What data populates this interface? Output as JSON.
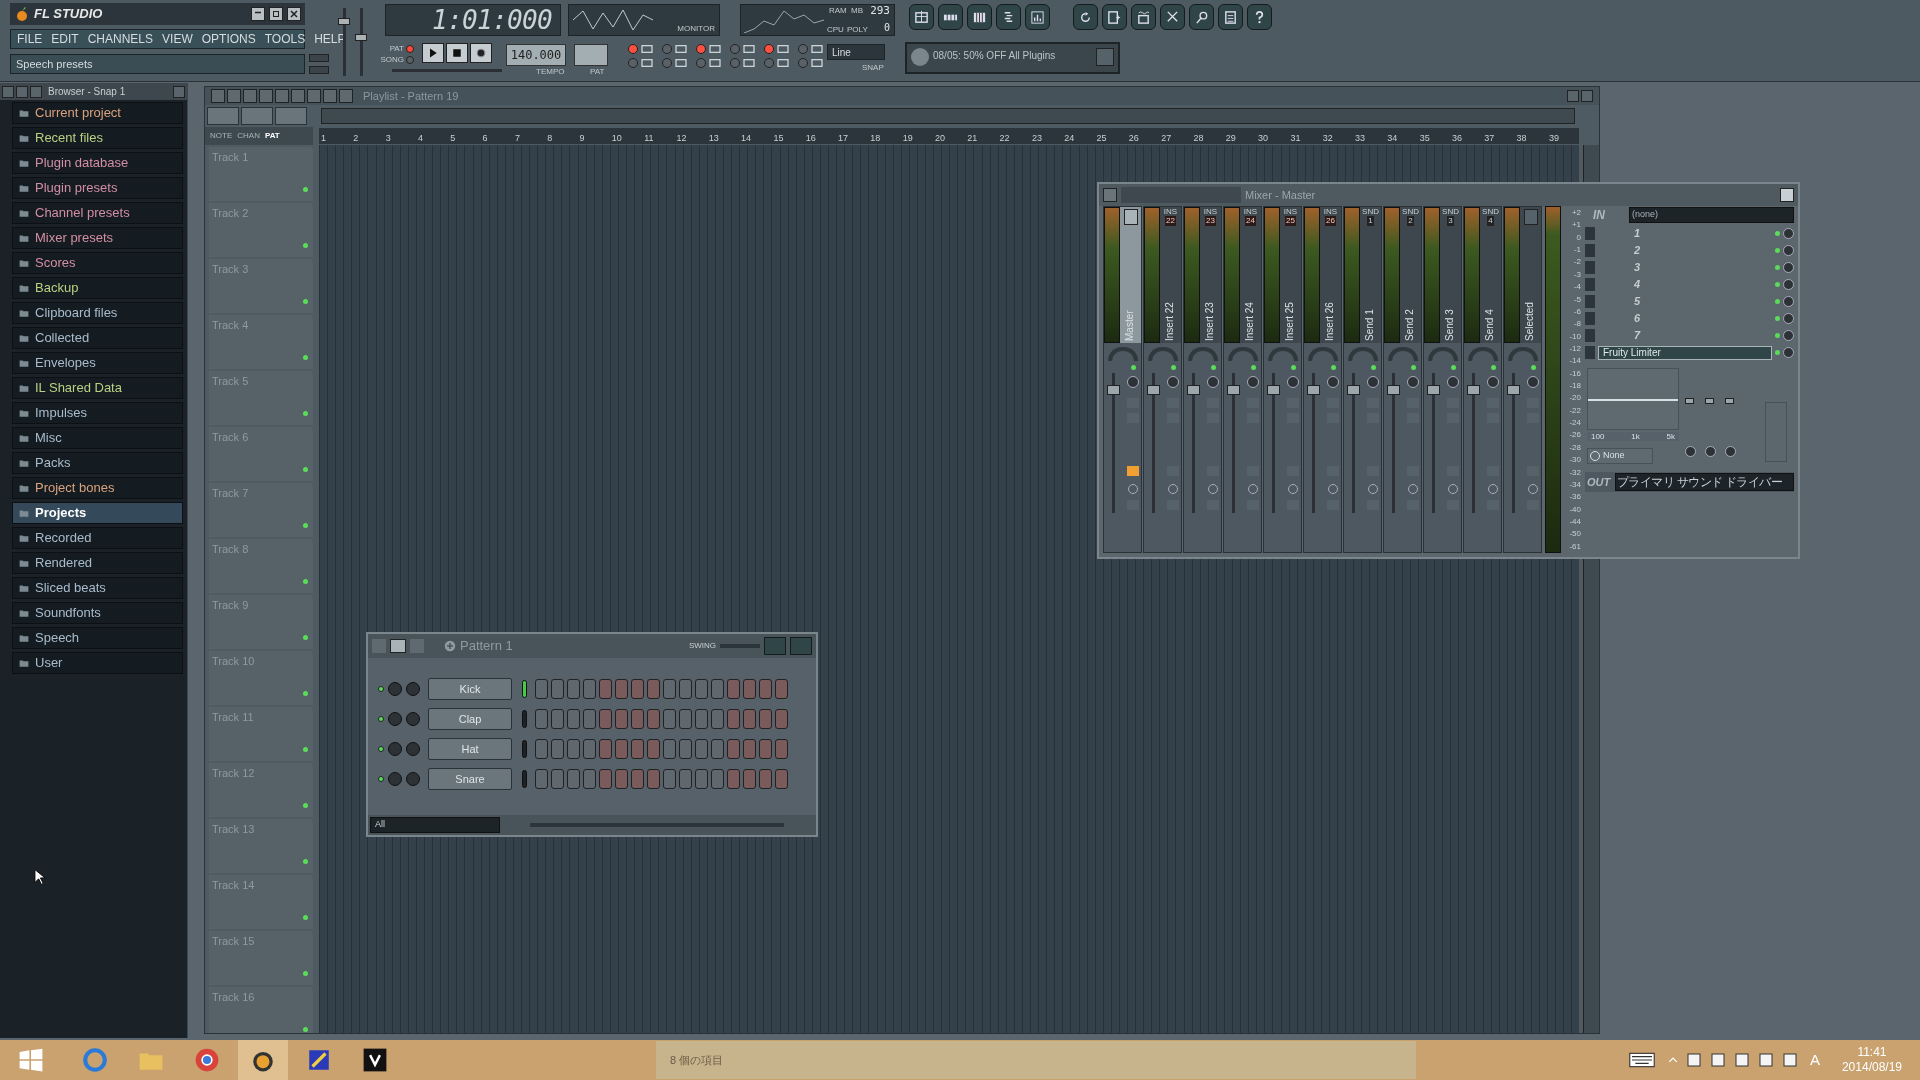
{
  "app": {
    "title": "FL STUDIO",
    "menu": [
      "FILE",
      "EDIT",
      "CHANNELS",
      "VIEW",
      "OPTIONS",
      "TOOLS",
      "HELP"
    ],
    "hint": "Speech presets"
  },
  "transport": {
    "time": "1:01:000",
    "modes": [
      {
        "label": "PAT",
        "selected": true
      },
      {
        "label": "SONG",
        "selected": false
      }
    ],
    "tempo": "140.000",
    "tempo_label": "TEMPO",
    "pattern_label": "PAT",
    "snap": "Line",
    "snap_label": "SNAP",
    "monitor_label": "MONITOR"
  },
  "cpu": {
    "value": "293",
    "ram_label": "RAM",
    "mb_label": "MB",
    "cpu_label": "CPU",
    "poly_label": "POLY",
    "poly": "0"
  },
  "news": "08/05: 50% OFF All Plugins",
  "browser": {
    "title": "Browser - Snap 1",
    "items": [
      {
        "label": "Current project",
        "color": "#d9a27e",
        "selected": false
      },
      {
        "label": "Recent files",
        "color": "#b9d182",
        "selected": false
      },
      {
        "label": "Plugin database",
        "color": "#d38ea4",
        "selected": false
      },
      {
        "label": "Plugin presets",
        "color": "#d38ea4",
        "selected": false
      },
      {
        "label": "Channel presets",
        "color": "#d38ea4",
        "selected": false
      },
      {
        "label": "Mixer presets",
        "color": "#d38ea4",
        "selected": false
      },
      {
        "label": "Scores",
        "color": "#d38ea4",
        "selected": false
      },
      {
        "label": "Backup",
        "color": "#b9d182",
        "selected": false
      },
      {
        "label": "Clipboard files",
        "color": "#a9bccd",
        "selected": false
      },
      {
        "label": "Collected",
        "color": "#a9bccd",
        "selected": false
      },
      {
        "label": "Envelopes",
        "color": "#a9bccd",
        "selected": false
      },
      {
        "label": "IL Shared Data",
        "color": "#b9d182",
        "selected": false
      },
      {
        "label": "Impulses",
        "color": "#a9bccd",
        "selected": false
      },
      {
        "label": "Misc",
        "color": "#a9bccd",
        "selected": false
      },
      {
        "label": "Packs",
        "color": "#a9bccd",
        "selected": false
      },
      {
        "label": "Project bones",
        "color": "#d9a27e",
        "selected": false
      },
      {
        "label": "Projects",
        "color": "#ffffff",
        "selected": true
      },
      {
        "label": "Recorded",
        "color": "#a9bccd",
        "selected": false
      },
      {
        "label": "Rendered",
        "color": "#a9bccd",
        "selected": false
      },
      {
        "label": "Sliced beats",
        "color": "#a9bccd",
        "selected": false
      },
      {
        "label": "Soundfonts",
        "color": "#a9bccd",
        "selected": false
      },
      {
        "label": "Speech",
        "color": "#a9bccd",
        "selected": false
      },
      {
        "label": "User",
        "color": "#a9bccd",
        "selected": false
      }
    ]
  },
  "playlist": {
    "title": "Playlist - Pattern 19",
    "tabs": [
      {
        "label": "NOTE",
        "selected": false
      },
      {
        "label": "CHAN",
        "selected": false
      },
      {
        "label": "PAT",
        "selected": true
      }
    ],
    "bars": [
      "1",
      "2",
      "3",
      "4",
      "5",
      "6",
      "7",
      "8",
      "9",
      "10",
      "11",
      "12",
      "13",
      "14",
      "15",
      "16",
      "17",
      "18",
      "19",
      "20",
      "21",
      "22",
      "23",
      "24",
      "25",
      "26",
      "27",
      "28",
      "29",
      "30",
      "31",
      "32",
      "33",
      "34",
      "35",
      "36",
      "37",
      "38",
      "39"
    ],
    "tracks": [
      "Track 1",
      "Track 2",
      "Track 3",
      "Track 4",
      "Track 5",
      "Track 6",
      "Track 7",
      "Track 8",
      "Track 9",
      "Track 10",
      "Track 11",
      "Track 12",
      "Track 13",
      "Track 14",
      "Track 15",
      "Track 16"
    ]
  },
  "mixer": {
    "title": "Mixer - Master",
    "strips": [
      {
        "name": "Master",
        "kind": "master",
        "selected": true
      },
      {
        "name": "Insert 22",
        "kind": "insert",
        "tag": "INS",
        "number": "22",
        "selected": false
      },
      {
        "name": "Insert 23",
        "kind": "insert",
        "tag": "INS",
        "number": "23",
        "selected": false
      },
      {
        "name": "Insert 24",
        "kind": "insert",
        "tag": "INS",
        "number": "24",
        "selected": false
      },
      {
        "name": "Insert 25",
        "kind": "insert",
        "tag": "INS",
        "number": "25",
        "selected": false
      },
      {
        "name": "Insert 26",
        "kind": "insert",
        "tag": "INS",
        "number": "26",
        "selected": false
      },
      {
        "name": "Send 1",
        "kind": "send",
        "tag": "SND",
        "number": "1",
        "selected": false
      },
      {
        "name": "Send 2",
        "kind": "send",
        "tag": "SND",
        "number": "2",
        "selected": false
      },
      {
        "name": "Send 3",
        "kind": "send",
        "tag": "SND",
        "number": "3",
        "selected": false
      },
      {
        "name": "Send 4",
        "kind": "send",
        "tag": "SND",
        "number": "4",
        "selected": false
      },
      {
        "name": "Selected",
        "kind": "current",
        "selected": false
      }
    ],
    "scale": [
      "+2",
      "+1",
      "0",
      "-1",
      "-2",
      "-3",
      "-4",
      "-5",
      "-6",
      "-8",
      "-10",
      "-12",
      "-14",
      "-16",
      "-18",
      "-20",
      "-22",
      "-24",
      "-26",
      "-28",
      "-30",
      "-32",
      "-34",
      "-36",
      "-40",
      "-44",
      "-50",
      "-61"
    ],
    "input": {
      "label": "IN",
      "value": "(none)"
    },
    "slots": [
      {
        "label": "1",
        "kind": "empty"
      },
      {
        "label": "2",
        "kind": "empty"
      },
      {
        "label": "3",
        "kind": "empty"
      },
      {
        "label": "4",
        "kind": "empty"
      },
      {
        "label": "5",
        "kind": "empty"
      },
      {
        "label": "6",
        "kind": "empty"
      },
      {
        "label": "7",
        "kind": "empty"
      },
      {
        "label": "Fruity Limiter",
        "kind": "plugin"
      }
    ],
    "eq_labels": [
      "100",
      "1k",
      "5k"
    ],
    "preset": "None",
    "output": {
      "label": "OUT",
      "value": "プライマリ サウンド ドライバー"
    }
  },
  "pattern": {
    "title": "Pattern 1",
    "swing_label": "SWING",
    "channels": [
      {
        "name": "Kick",
        "selected": true
      },
      {
        "name": "Clap",
        "selected": false
      },
      {
        "name": "Hat",
        "selected": false
      },
      {
        "name": "Snare",
        "selected": false
      }
    ],
    "filter": "All"
  },
  "taskbar": {
    "status": "8 個の項目",
    "ime": "A",
    "time": "11:41",
    "date": "2014/08/19"
  }
}
